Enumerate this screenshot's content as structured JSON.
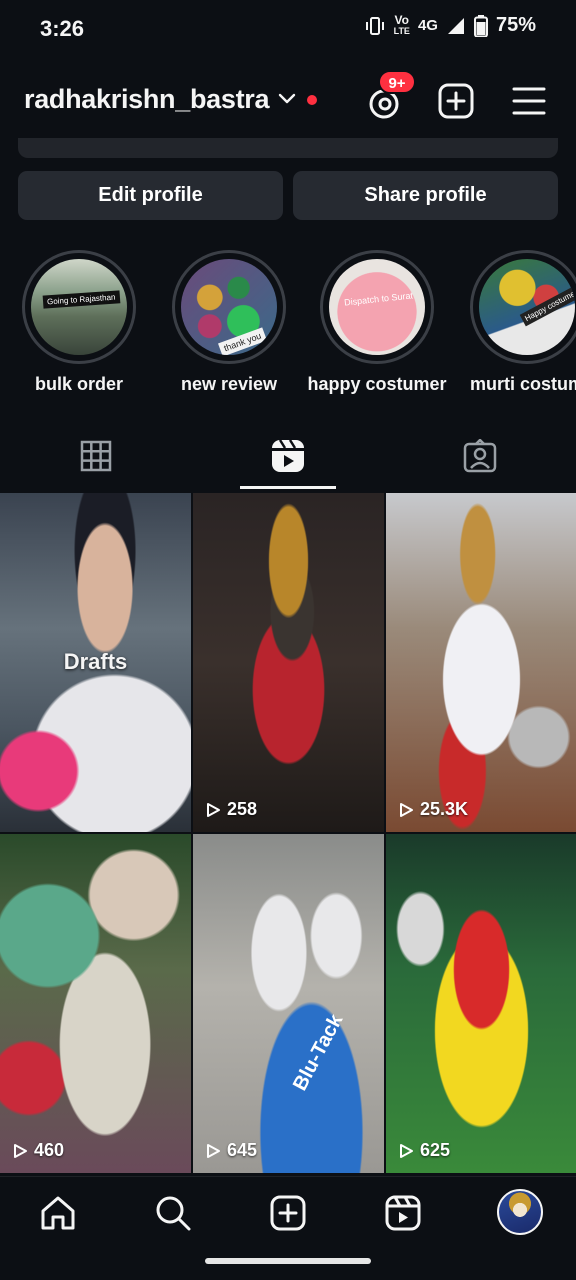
{
  "status_bar": {
    "time": "3:26",
    "volte_top": "Vo",
    "volte_bottom": "LTE",
    "network": "4G",
    "battery": "75%"
  },
  "header": {
    "username": "radhakrishn_bastra",
    "notification_badge": "9+"
  },
  "profile_actions": {
    "edit_label": "Edit profile",
    "share_label": "Share profile"
  },
  "highlights": [
    {
      "label": "bulk order",
      "overlay": "Going to Rajasthan"
    },
    {
      "label": "new review",
      "overlay": "thank you"
    },
    {
      "label": "happy costumer",
      "overlay": "Dispatch to Surat"
    },
    {
      "label": "murti costum",
      "overlay": "Happy costumer"
    }
  ],
  "tabs": [
    "grid",
    "reels",
    "tagged"
  ],
  "reels": [
    {
      "kind": "draft",
      "label": "Drafts"
    },
    {
      "kind": "reel",
      "views": "258"
    },
    {
      "kind": "reel",
      "views": "25.3K"
    },
    {
      "kind": "reel",
      "views": "460"
    },
    {
      "kind": "reel",
      "views": "645",
      "visible_text": "Blu-Tack"
    },
    {
      "kind": "reel",
      "views": "625"
    }
  ],
  "bottom_nav": [
    "home-icon",
    "search-icon",
    "create-icon",
    "reels-icon",
    "profile-avatar"
  ],
  "colors": {
    "background": "#0c0f14",
    "button": "#262a31",
    "accent_red": "#ff3040",
    "text": "#f5f5f5"
  }
}
